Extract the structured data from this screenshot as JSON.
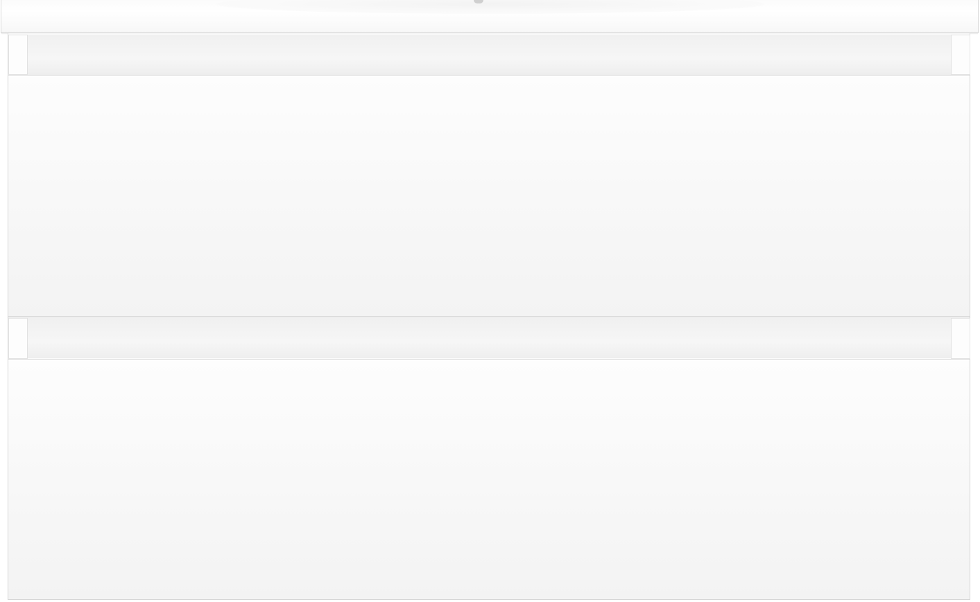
{
  "product": {
    "type": "wall-hung vanity unit",
    "finish_color": "#ffffff",
    "drawers": [
      {
        "id": "top"
      },
      {
        "id": "bottom"
      }
    ]
  }
}
